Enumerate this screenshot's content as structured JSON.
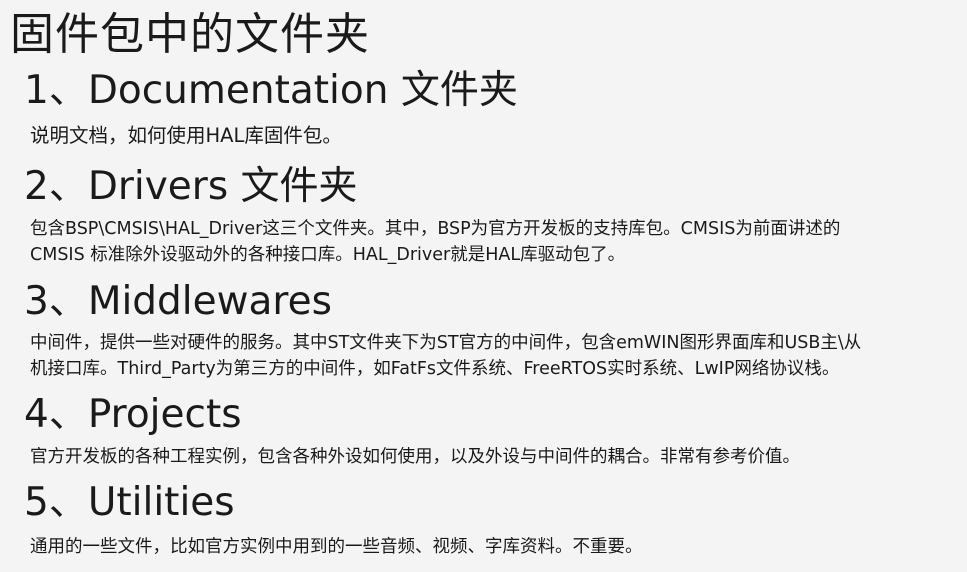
{
  "title": "固件包中的文件夹",
  "sections": [
    {
      "heading": "1、Documentation 文件夹",
      "lines": [
        "说明文档，如何使用HAL库固件包。"
      ]
    },
    {
      "heading": "2、Drivers 文件夹",
      "lines": [
        "包含BSP\\CMSIS\\HAL_Driver这三个文件夹。其中，BSP为官方开发板的支持库包。CMSIS为前面讲述的",
        "CMSIS 标准除外设驱动外的各种接口库。HAL_Driver就是HAL库驱动包了。"
      ]
    },
    {
      "heading": "3、Middlewares",
      "lines": [
        "中间件，提供一些对硬件的服务。其中ST文件夹下为ST官方的中间件，包含emWIN图形界面库和USB主\\从",
        "机接口库。Third_Party为第三方的中间件，如FatFs文件系统、FreeRTOS实时系统、LwIP网络协议栈。"
      ]
    },
    {
      "heading": "4、Projects",
      "lines": [
        "官方开发板的各种工程实例，包含各种外设如何使用，以及外设与中间件的耦合。非常有参考价值。"
      ]
    },
    {
      "heading": "5、Utilities",
      "lines": [
        "通用的一些文件，比如官方实例中用到的一些音频、视频、字库资料。不重要。"
      ]
    }
  ]
}
